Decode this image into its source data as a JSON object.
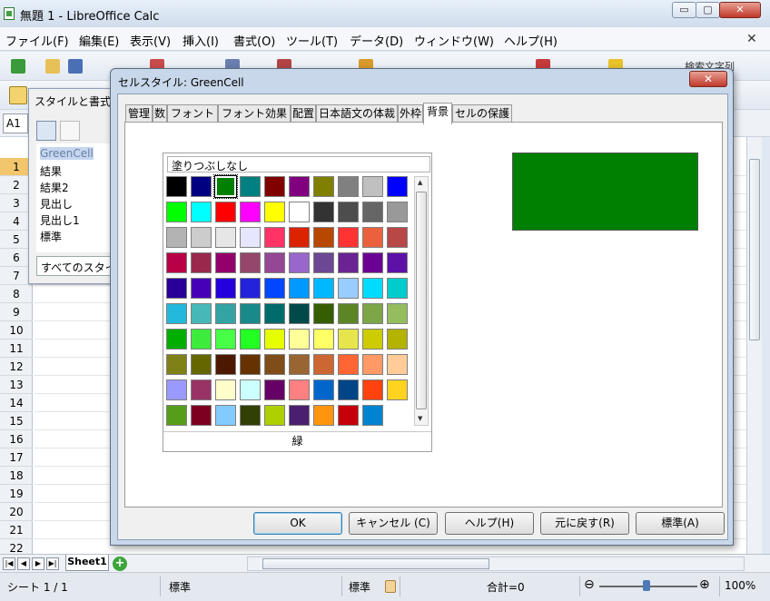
{
  "window": {
    "title": "無題 1 - LibreOffice Calc",
    "min": "▭",
    "max": "▢",
    "close": "✕"
  },
  "menubar": [
    "ファイル(F)",
    "編集(E)",
    "表示(V)",
    "挿入(I)",
    "書式(O)",
    "ツール(T)",
    "データ(D)",
    "ウィンドウ(W)",
    "ヘルプ(H)"
  ],
  "menu_close": "✕",
  "toolbar": {
    "search_label": "検索文字列"
  },
  "formula": {
    "name_box": "A1"
  },
  "rows": [
    "1",
    "2",
    "3",
    "4",
    "5",
    "6",
    "7",
    "8",
    "9",
    "10",
    "11",
    "12",
    "13",
    "14",
    "15",
    "16",
    "17",
    "18",
    "19",
    "20",
    "21",
    "22"
  ],
  "styles_panel": {
    "title": "スタイルと書式",
    "items": [
      "GreenCell",
      "結果",
      "結果2",
      "見出し",
      "見出し1",
      "標準"
    ],
    "filter": "すべてのスタイル"
  },
  "sheet_tab": "Sheet1",
  "statusbar": {
    "sheet": "シート 1 / 1",
    "style": "標準",
    "mode": "標準",
    "sum": "合計=0",
    "zoom": "100%",
    "minus": "⊖",
    "plus": "⊕"
  },
  "dialog": {
    "title": "セルスタイル: GreenCell",
    "close": "✕",
    "tabs": [
      "管理",
      "数",
      "フォント",
      "フォント効果",
      "配置",
      "日本語文の体裁",
      "外枠",
      "背景",
      "セルの保護"
    ],
    "no_fill": "塗りつぶしなし",
    "selected_color_name": "緑",
    "preview_color": "#008000",
    "buttons": {
      "ok": "OK",
      "cancel": "キャンセル (C)",
      "help": "ヘルプ(H)",
      "reset": "元に戻す(R)",
      "standard": "標準(A)"
    }
  },
  "palette": [
    "#000000",
    "#000080",
    "#008000",
    "#008080",
    "#800000",
    "#800080",
    "#808000",
    "#808080",
    "#c0c0c0",
    "#0000ff",
    "#00ff00",
    "#00ffff",
    "#ff0000",
    "#ff00ff",
    "#ffff00",
    "#ffffff",
    "#333333",
    "#4d4d4d",
    "#666666",
    "#999999",
    "#b3b3b3",
    "#cccccc",
    "#e6e6e6",
    "#e6e6ff",
    "#ff3366",
    "#dc2300",
    "#b84700",
    "#ff3333",
    "#eb613d",
    "#b84747",
    "#b80047",
    "#99284c",
    "#94006b",
    "#94476b",
    "#944794",
    "#9966cc",
    "#6b4794",
    "#6b2394",
    "#6b0094",
    "#5e11a6",
    "#280099",
    "#4700b8",
    "#2300dc",
    "#2323dc",
    "#0047ff",
    "#0099ff",
    "#00b8ff",
    "#99ccff",
    "#00dcff",
    "#00cccc",
    "#23b8dc",
    "#47b8b8",
    "#33a3a3",
    "#198a8a",
    "#006b6b",
    "#004a4a",
    "#355e00",
    "#5c8526",
    "#7da647",
    "#94bd5e",
    "#00ae00",
    "#3deb3d",
    "#47ff47",
    "#23ff23",
    "#e6ff00",
    "#ffff99",
    "#ffff66",
    "#e6e64c",
    "#cccc00",
    "#b3b300",
    "#808019",
    "#666600",
    "#4c1900",
    "#663300",
    "#804d1a",
    "#996633",
    "#cc6633",
    "#ff6633",
    "#ff9966",
    "#ffcc99",
    "#9999ff",
    "#993366",
    "#ffffcc",
    "#ccffff",
    "#660066",
    "#ff8080",
    "#0066cc",
    "#004586",
    "#ff420e",
    "#ffd320",
    "#579d1c",
    "#7e0021",
    "#83caff",
    "#314004",
    "#aecf00",
    "#4b1f6f",
    "#ff950e",
    "#c5000b",
    "#0084d1"
  ]
}
